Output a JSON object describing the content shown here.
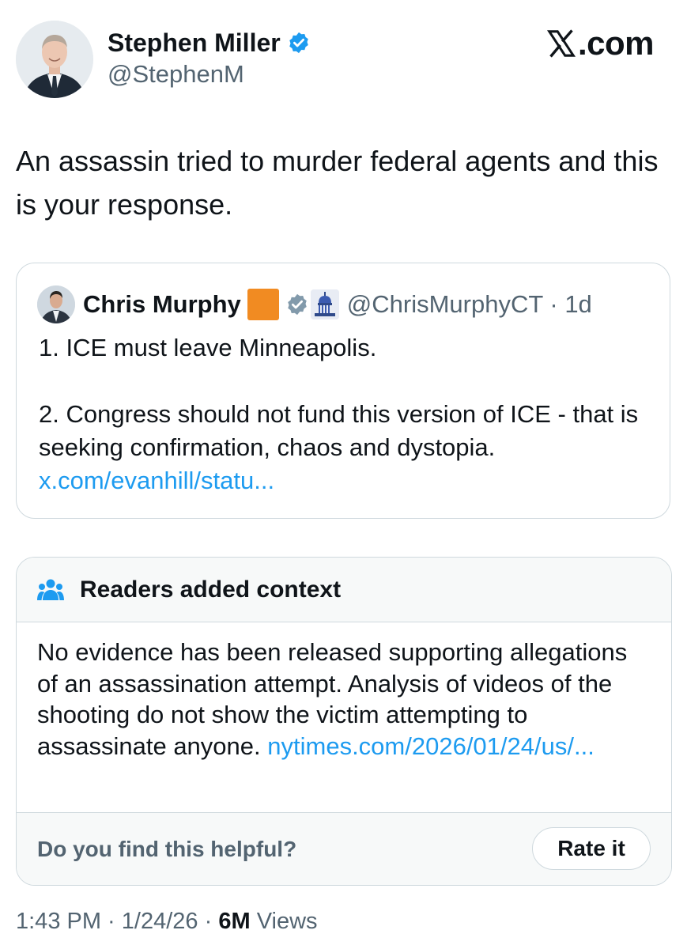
{
  "brand": {
    "site": ".com",
    "logo_icon": "x-logo-icon"
  },
  "author": {
    "name": "Stephen Miller",
    "handle": "@StephenM",
    "verified_color": "#1d9bf0"
  },
  "tweet": {
    "text": "An assassin tried to murder federal agents and this is your response."
  },
  "quote": {
    "author_name": "Chris Murphy",
    "badges": [
      "orange-square-badge",
      "gray-verified-icon",
      "capitol-badge"
    ],
    "handle": "@ChrisMurphyCT",
    "separator": " · ",
    "age": "1d",
    "line1": "1. ICE must leave Minneapolis.",
    "line2": "2. Congress should not fund this version of ICE - that is seeking confirmation, chaos and dystopia.",
    "link": "x.com/evanhill/statu..."
  },
  "community_note": {
    "title": "Readers added context",
    "body": "No evidence has been released supporting allegations of an assassination attempt.  Analysis of videos of the shooting do not show the victim attempting to assassinate anyone.",
    "link": "nytimes.com/2026/01/24/us/...",
    "helpful_question": "Do you find this helpful?",
    "rate_button": "Rate it"
  },
  "meta": {
    "time": "1:43 PM",
    "date": "1/24/26",
    "separator": " · ",
    "views_count": "6M",
    "views_label": "Views"
  },
  "colors": {
    "link": "#1d9bf0",
    "secondary_text": "#536471",
    "border": "#cfd9de",
    "note_background": "#f7f9f9",
    "orange_badge": "#f18b22"
  }
}
